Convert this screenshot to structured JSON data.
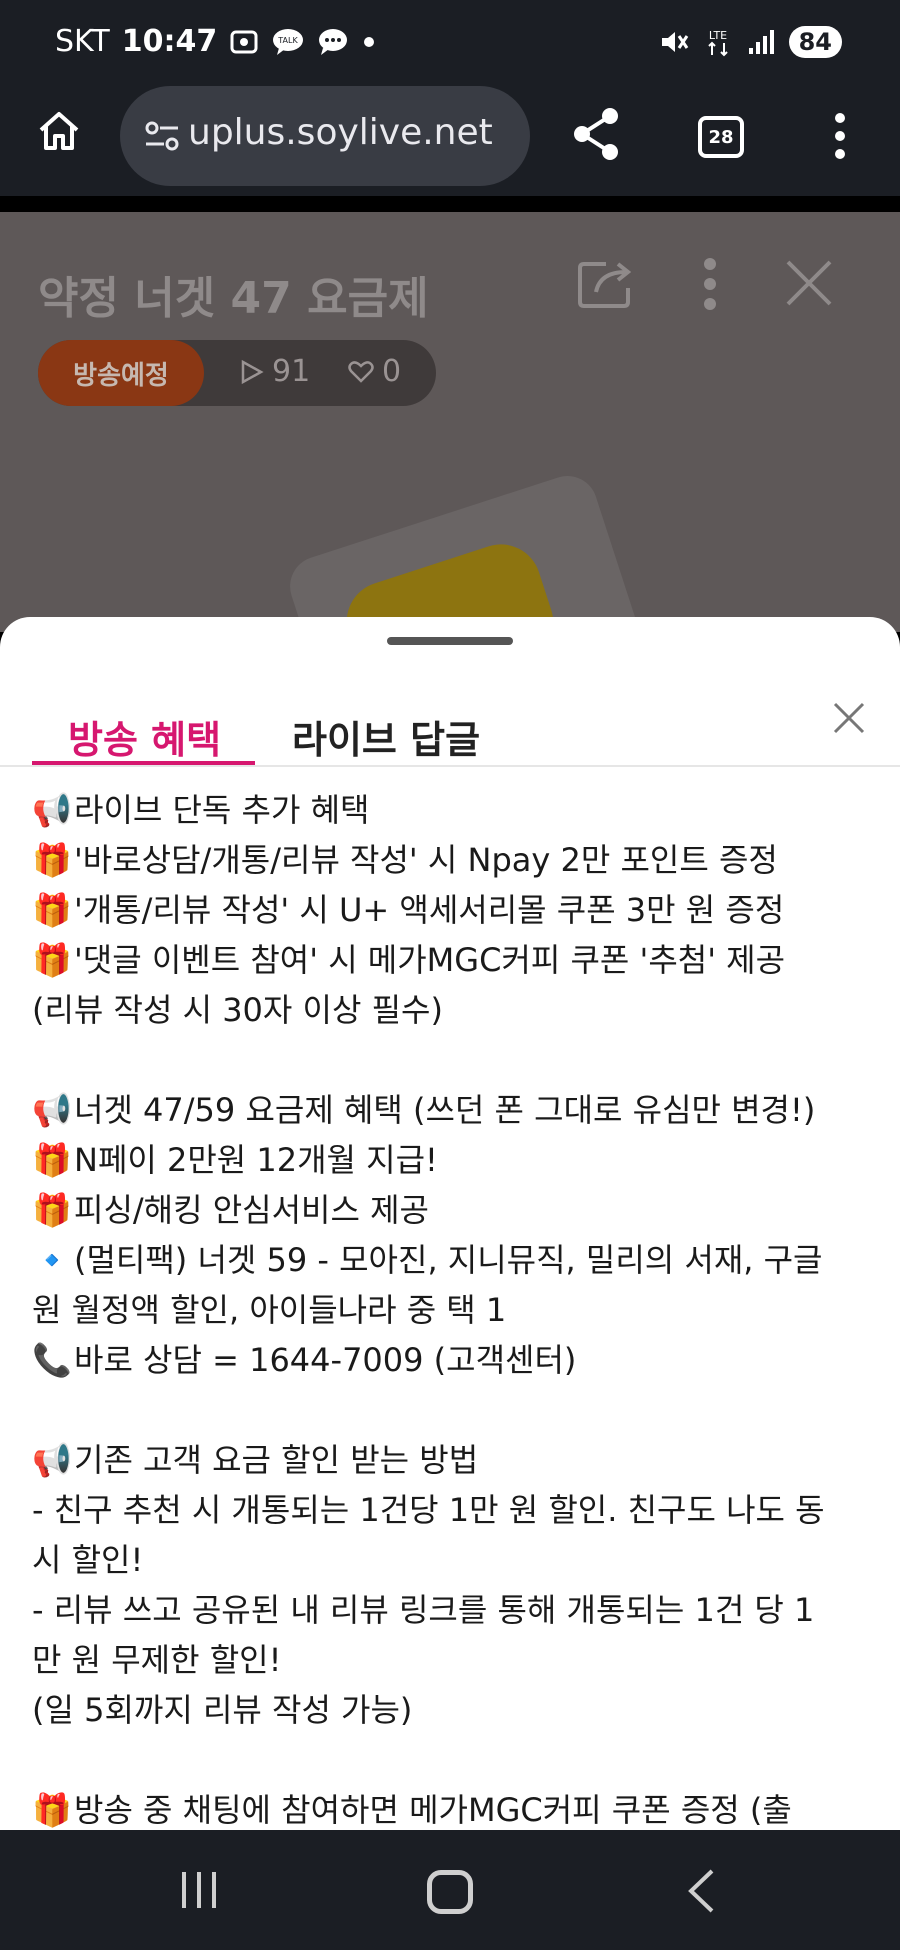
{
  "status_bar": {
    "carrier": "SKT",
    "time": "10:47",
    "notification_icons": [
      "screenshot-icon",
      "kakaotalk-icon",
      "message-icon",
      "dot-icon"
    ],
    "battery": "84",
    "network": "LTE"
  },
  "browser": {
    "url": "uplus.soylive.net",
    "tab_count": "28"
  },
  "video": {
    "title": "약정 너겟 47 요금제",
    "status_badge": "방송예정",
    "views": "91",
    "likes": "0"
  },
  "sheet": {
    "tabs": [
      {
        "label": "방송 혜택",
        "active": true
      },
      {
        "label": "라이브 답글",
        "active": false
      }
    ],
    "lines": [
      {
        "emoji": "📢",
        "text": "라이브 단독 추가 혜택"
      },
      {
        "emoji": "🎁",
        "text": "'바로상담/개통/리뷰 작성' 시 Npay 2만 포인트 증정"
      },
      {
        "emoji": "🎁",
        "text": "'개통/리뷰 작성' 시 U+ 액세서리몰 쿠폰 3만 원 증정"
      },
      {
        "emoji": "🎁",
        "text": "'댓글 이벤트 참여' 시 메가MGC커피 쿠폰 '추첨' 제공"
      },
      {
        "emoji": "",
        "text": "(리뷰 작성 시 30자 이상 필수)"
      },
      {
        "emoji": "",
        "text": ""
      },
      {
        "emoji": "📢",
        "text": "너겟 47/59 요금제 혜택 (쓰던 폰 그대로 유심만 변경!)"
      },
      {
        "emoji": "🎁",
        "text": "N페이 2만원 12개월 지급!"
      },
      {
        "emoji": "🎁",
        "text": "피싱/해킹 안심서비스 제공"
      },
      {
        "emoji": "🔹",
        "text": "(멀티팩) 너겟 59 - 모아진, 지니뮤직, 밀리의 서재, 구글"
      },
      {
        "emoji": "",
        "text": "원 월정액 할인, 아이들나라 중 택 1"
      },
      {
        "emoji": "📞",
        "text": "바로 상담 = 1644-7009 (고객센터)"
      },
      {
        "emoji": "",
        "text": ""
      },
      {
        "emoji": "📢",
        "text": "기존 고객 요금 할인 받는 방법"
      },
      {
        "emoji": "",
        "text": "- 친구 추천 시 개통되는 1건당 1만 원 할인. 친구도 나도 동"
      },
      {
        "emoji": "",
        "text": "시 할인!"
      },
      {
        "emoji": "",
        "text": "- 리뷰 쓰고 공유된 내 리뷰 링크를 통해 개통되는 1건 당 1"
      },
      {
        "emoji": "",
        "text": "만 원 무제한 할인!"
      },
      {
        "emoji": "",
        "text": "(일 5회까지 리뷰 작성 가능)"
      },
      {
        "emoji": "",
        "text": ""
      },
      {
        "emoji": "🎁",
        "text": "방송 중 채팅에 참여하면 메가MGC커피 쿠폰 증정 (출"
      }
    ]
  },
  "colors": {
    "accent": "#d6176f",
    "status_badge_bg": "#8a3714",
    "system_bar_bg": "#1b1e24"
  }
}
